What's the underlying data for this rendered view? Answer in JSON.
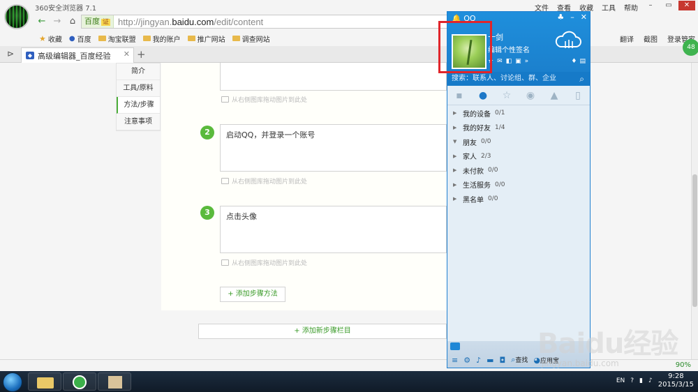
{
  "browser": {
    "app_title": "360安全浏览器 7.1",
    "menu": [
      "文件",
      "查看",
      "收藏",
      "工具",
      "帮助"
    ],
    "url_tag": "百度",
    "url_cert": "证",
    "url_prefix": "http://jingyan.",
    "url_domain": "baidu.com",
    "url_path": "/edit/content",
    "bookmarks": [
      "收藏",
      "百度",
      "淘宝联盟",
      "我的账户",
      "推广网站",
      "调查网站"
    ],
    "bookmarks_right": [
      "翻译",
      "截图",
      "登录管家"
    ],
    "tab_label": "高级编辑器_百度经验",
    "badge": "48",
    "zoom": "90%"
  },
  "editor": {
    "sidenav": [
      "简介",
      "工具/原料",
      "方法/步骤",
      "注意事项"
    ],
    "drop_hint": "从右侧图库拖动图片到此处",
    "steps": [
      {
        "num": "2",
        "text": "启动QQ，并登录一个账号"
      },
      {
        "num": "3",
        "text": "点击头像"
      }
    ],
    "add_method": "+ 添加步骤方法",
    "add_column": "+ 添加新步骤栏目"
  },
  "qq": {
    "brand": "QQ",
    "nick": "十剑",
    "signature": "编辑个性签名",
    "search_placeholder": "搜索：联系人、讨论组、群、企业",
    "groups": [
      {
        "name": "我的设备",
        "count": "0/1",
        "expanded": false
      },
      {
        "name": "我的好友",
        "count": "1/4",
        "expanded": false
      },
      {
        "name": "朋友",
        "count": "0/0",
        "expanded": true
      },
      {
        "name": "家人",
        "count": "2/3",
        "expanded": false
      },
      {
        "name": "未付款",
        "count": "0/0",
        "expanded": false
      },
      {
        "name": "生活服务",
        "count": "0/0",
        "expanded": false
      },
      {
        "name": "黑名单",
        "count": "0/0",
        "expanded": false
      }
    ],
    "find_label": "查找",
    "app_store_label": "应用宝",
    "highlight_color": "#e0252b"
  },
  "taskbar": {
    "lang": "EN",
    "time": "9:28",
    "date": "2015/3/15"
  },
  "watermark": {
    "main": "Baidu经验",
    "sub": "jingyan.baidu.com"
  }
}
